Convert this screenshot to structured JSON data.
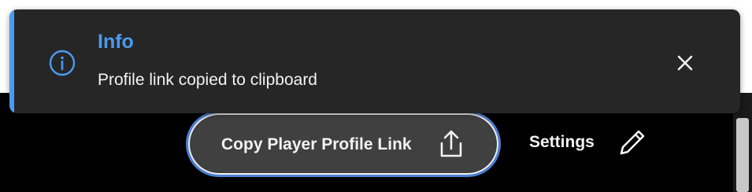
{
  "toast": {
    "type_icon": "info-circle-icon",
    "title": "Info",
    "message": "Profile link copied to clipboard",
    "close_icon": "close-icon",
    "accent_color": "#4a9bf0"
  },
  "actions": {
    "copy_profile_link_label": "Copy Player Profile Link",
    "copy_icon": "share-upload-icon",
    "settings_label": "Settings",
    "settings_icon": "pencil-icon",
    "button_border_color": "#4a7fd4"
  }
}
